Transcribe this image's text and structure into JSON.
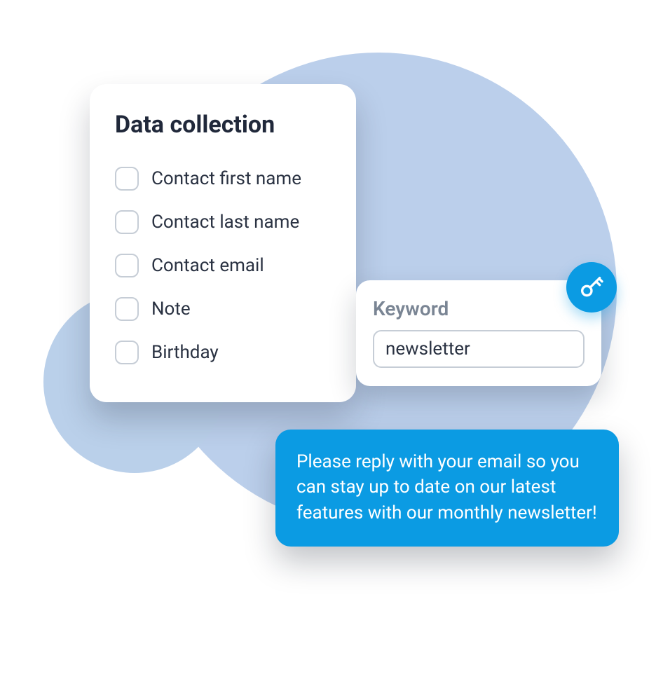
{
  "data_collection": {
    "title": "Data collection",
    "items": [
      {
        "label": "Contact first name"
      },
      {
        "label": "Contact last name"
      },
      {
        "label": "Contact email"
      },
      {
        "label": "Note"
      },
      {
        "label": "Birthday"
      }
    ]
  },
  "keyword_card": {
    "title": "Keyword",
    "value": "newsletter"
  },
  "message": {
    "text": "Please reply with your email so you can stay up to date on our latest features with our monthly newsletter!"
  }
}
